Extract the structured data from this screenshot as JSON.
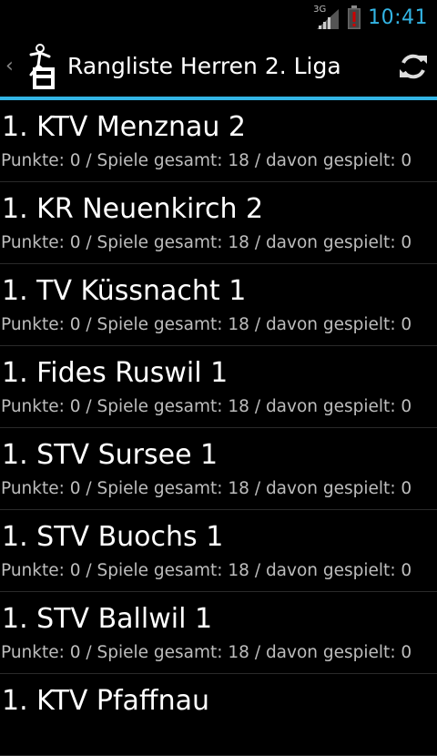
{
  "status": {
    "network_type": "3G",
    "time": "10:41"
  },
  "actionbar": {
    "title": "Rangliste Herren 2. Liga"
  },
  "teams": [
    {
      "name": "1. KTV Menznau 2",
      "details": "Punkte: 0 / Spiele gesamt: 18 / davon gespielt: 0"
    },
    {
      "name": "1. KR Neuenkirch 2",
      "details": "Punkte: 0 / Spiele gesamt: 18 / davon gespielt: 0"
    },
    {
      "name": "1. TV Küssnacht 1",
      "details": "Punkte: 0 / Spiele gesamt: 18 / davon gespielt: 0"
    },
    {
      "name": "1. Fides Ruswil 1",
      "details": "Punkte: 0 / Spiele gesamt: 18 / davon gespielt: 0"
    },
    {
      "name": "1. STV Sursee 1",
      "details": "Punkte: 0 / Spiele gesamt: 18 / davon gespielt: 0"
    },
    {
      "name": "1. STV Buochs 1",
      "details": "Punkte: 0 / Spiele gesamt: 18 / davon gespielt: 0"
    },
    {
      "name": "1. STV Ballwil 1",
      "details": "Punkte: 0 / Spiele gesamt: 18 / davon gespielt: 0"
    },
    {
      "name": "1. KTV Pfaffnau",
      "details": ""
    }
  ],
  "colors": {
    "accent": "#33b5e5",
    "background": "#000000",
    "battery_alert": "#cc0000"
  },
  "icons": [
    "signal-icon",
    "battery-alert-icon",
    "up-caret-icon",
    "app-logo-icon",
    "refresh-icon"
  ]
}
